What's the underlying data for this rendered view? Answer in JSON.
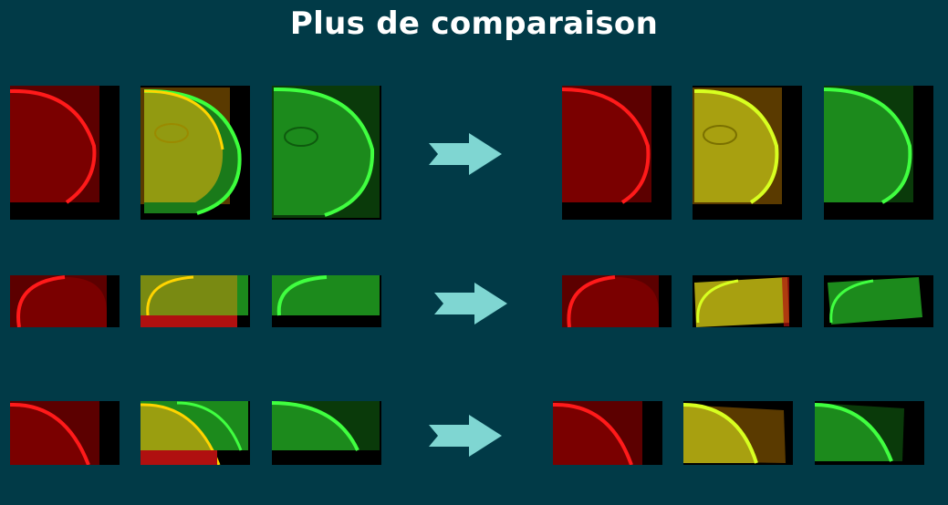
{
  "title": "Plus de comparaison",
  "colors": {
    "background": "#013a47",
    "arrow": "#7fd6d2",
    "red_channel": "#ff1a1a",
    "green_channel": "#22e022",
    "overlay": "#c8d020"
  },
  "icons": {
    "arrow": "right-arrow-icon"
  },
  "rows": [
    {
      "before": [
        "red-channel-image",
        "overlay-image",
        "green-channel-image"
      ],
      "after": [
        "red-channel-image",
        "overlay-image",
        "green-channel-image"
      ]
    },
    {
      "before": [
        "red-channel-image",
        "overlay-image",
        "green-channel-image"
      ],
      "after": [
        "red-channel-image",
        "overlay-image",
        "green-channel-image"
      ]
    },
    {
      "before": [
        "red-channel-image",
        "overlay-image",
        "green-channel-image"
      ],
      "after": [
        "red-channel-image",
        "overlay-image",
        "green-channel-image"
      ]
    }
  ]
}
